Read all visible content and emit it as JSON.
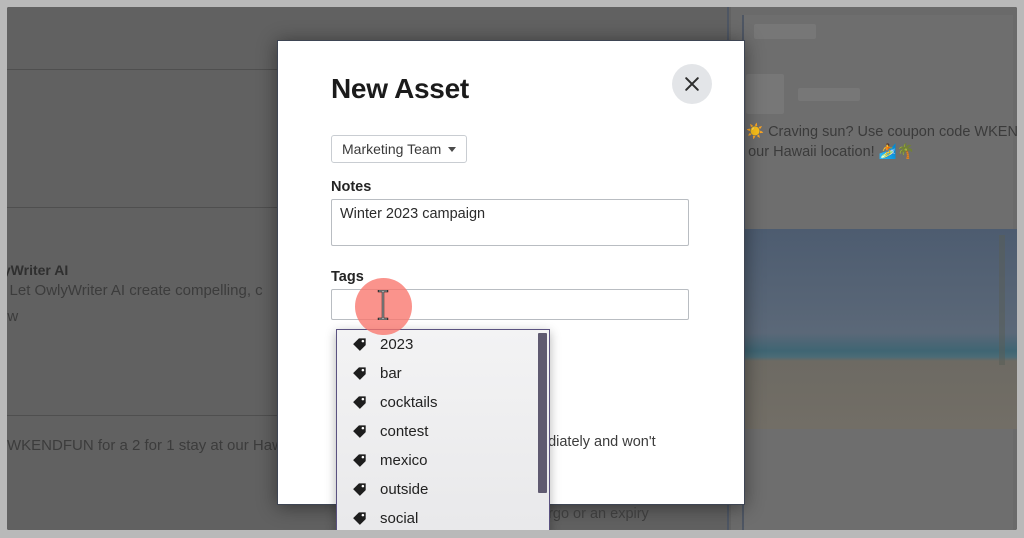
{
  "modal": {
    "title": "New Asset",
    "close_icon": "close-icon",
    "team_select": {
      "value": "Marketing Team",
      "caret_icon": "chevron-down-icon"
    },
    "notes": {
      "label": "Notes",
      "value": "Winter 2023 campaign",
      "placeholder": ""
    },
    "tags": {
      "label": "Tags",
      "value": "",
      "placeholder": ""
    },
    "body_text": [
      "ediately and won't",
      "argo or an expiry"
    ]
  },
  "tag_dropdown": {
    "tag_icon": "tag-icon",
    "options": [
      "2023",
      "bar",
      "cocktails",
      "contest",
      "mexico",
      "outside",
      "social"
    ]
  },
  "background": {
    "left_column": {
      "heading": "lyWriter AI",
      "line_1": "? Let OwlyWriter AI create compelling, c",
      "line_2": "ow",
      "line_3": "WKENDFUN for a 2 for 1 stay at our Haw"
    },
    "right_column": {
      "post_line_1": "☀️ Craving sun? Use coupon code WKEN",
      "post_line_2": "at our Hawaii location! 🏄🌴"
    }
  },
  "colors": {
    "overlay": "#626262",
    "modal_bg": "#ffffff",
    "dropdown_border": "#5a5280",
    "highlight": "#f8746b",
    "close_button_bg": "#e3e5e8"
  }
}
